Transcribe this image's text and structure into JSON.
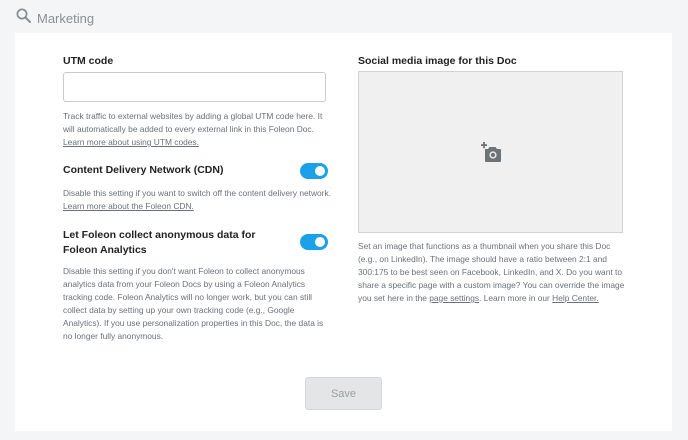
{
  "header": {
    "title": "Marketing",
    "icon": "search-icon"
  },
  "utm": {
    "label": "UTM code",
    "value": "",
    "placeholder": "",
    "help_text": "Track traffic to external websites by adding a global UTM code here. It will automatically be added to every external link in this Foleon Doc. ",
    "help_link": "Learn more about using UTM codes."
  },
  "cdn": {
    "label": "Content Delivery Network (CDN)",
    "enabled": true,
    "help_text": "Disable this setting if you want to switch off the content delivery network. ",
    "help_link": "Learn more about the Foleon CDN."
  },
  "analytics": {
    "label": "Let Foleon collect anonymous data for Foleon Analytics",
    "enabled": true,
    "help_text": "Disable this setting if you don't want Foleon to collect anonymous analytics data from your Foleon Docs by using a Foleon Analytics tracking code. Foleon Analytics will no longer work, but you can still collect data by setting up your own tracking code (e.g., Google Analytics). If you use personalization properties in this Doc, the data is no longer fully anonymous."
  },
  "social": {
    "label": "Social media image for this Doc",
    "upload_icon": "add-photo-icon",
    "help_text_1": "Set an image that functions as a thumbnail when you share this Doc (e.g., on LinkedIn). The image should have a ratio between 2:1 and 300:175 to be best seen on Facebook, LinkedIn, and X. Do you want to share a specific page with a custom image? You can override the image you set here in the ",
    "help_link_1": "page settings",
    "help_text_2": ". Learn more in our ",
    "help_link_2": "Help Center."
  },
  "footer": {
    "save_label": "Save"
  },
  "colors": {
    "accent": "#1ba1ea",
    "muted": "#6b7178",
    "background": "#f4f5f6"
  }
}
